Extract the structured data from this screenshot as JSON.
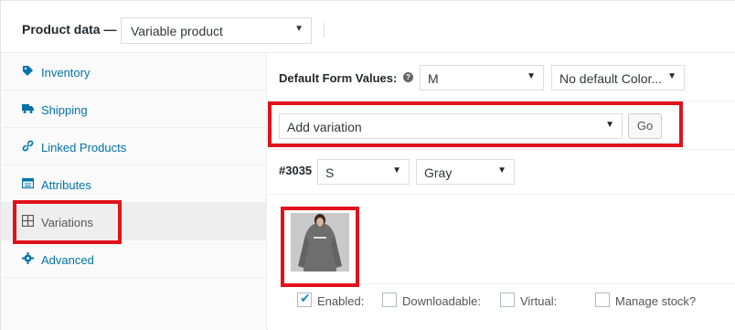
{
  "header": {
    "label": "Product data —",
    "product_type": "Variable product"
  },
  "sidebar": {
    "items": [
      {
        "label": "Inventory",
        "icon": "tag-icon"
      },
      {
        "label": "Shipping",
        "icon": "truck-icon"
      },
      {
        "label": "Linked Products",
        "icon": "link-icon"
      },
      {
        "label": "Attributes",
        "icon": "list-icon"
      },
      {
        "label": "Variations",
        "icon": "grid-icon",
        "active": true
      },
      {
        "label": "Advanced",
        "icon": "gear-icon"
      }
    ]
  },
  "defaults": {
    "label": "Default Form Values:",
    "size_value": "M",
    "color_value": "No default Color..."
  },
  "add_variation": {
    "select_value": "Add variation",
    "go_label": "Go"
  },
  "variation": {
    "id": "#3035",
    "size": "S",
    "color": "Gray",
    "options": [
      {
        "label": "Enabled:",
        "checked": true
      },
      {
        "label": "Downloadable:",
        "checked": false
      },
      {
        "label": "Virtual:",
        "checked": false
      },
      {
        "label": "Manage stock?",
        "checked": false
      }
    ]
  },
  "colors": {
    "highlight": "#e0121b",
    "link": "#0073aa"
  }
}
